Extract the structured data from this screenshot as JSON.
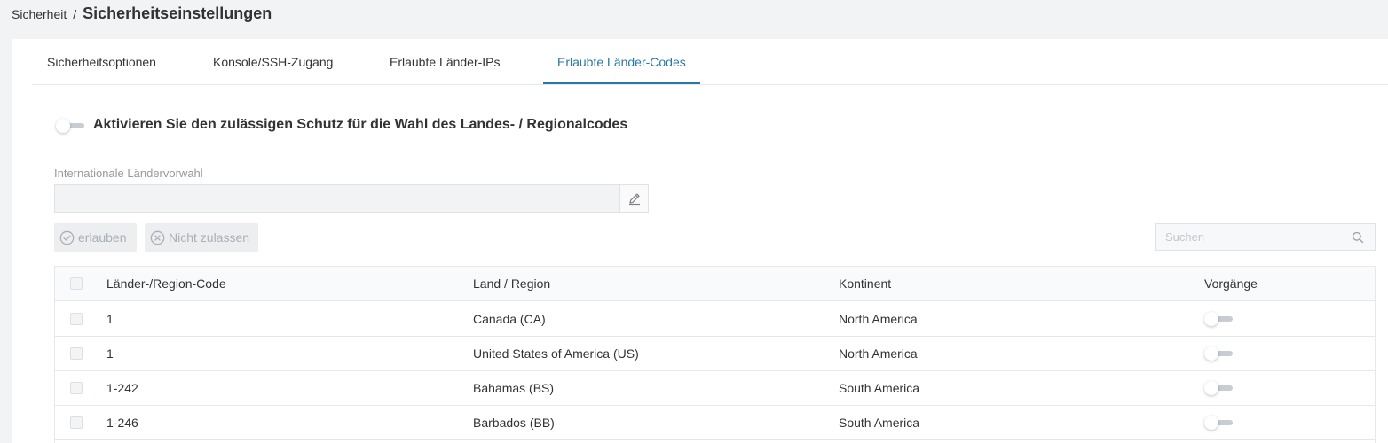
{
  "breadcrumb": {
    "parent": "Sicherheit",
    "separator": "/",
    "current": "Sicherheitseinstellungen"
  },
  "tabs": [
    {
      "label": "Sicherheitsoptionen",
      "active": false
    },
    {
      "label": "Konsole/SSH-Zugang",
      "active": false
    },
    {
      "label": "Erlaubte Länder-IPs",
      "active": false
    },
    {
      "label": "Erlaubte Länder-Codes",
      "active": true
    }
  ],
  "protection": {
    "label": "Aktivieren Sie den zulässigen Schutz für die Wahl des Landes- / Regionalcodes",
    "enabled": false
  },
  "country_code_field": {
    "label": "Internationale Ländervorwahl",
    "value": "",
    "edit_icon": "pencil-icon"
  },
  "actions": {
    "allow_label": "erlauben",
    "deny_label": "Nicht zulassen"
  },
  "search": {
    "placeholder": "Suchen"
  },
  "table": {
    "columns": [
      "Länder-/Region-Code",
      "Land / Region",
      "Kontinent",
      "Vorgänge"
    ],
    "rows": [
      {
        "code": "1",
        "country": "Canada (CA)",
        "continent": "North America",
        "enabled": false
      },
      {
        "code": "1",
        "country": "United States of America (US)",
        "continent": "North America",
        "enabled": false
      },
      {
        "code": "1-242",
        "country": "Bahamas (BS)",
        "continent": "South America",
        "enabled": false
      },
      {
        "code": "1-246",
        "country": "Barbados (BB)",
        "continent": "South America",
        "enabled": false
      }
    ]
  },
  "colors": {
    "accent": "#2a76a6",
    "page_background": "#f2f3f5",
    "disabled_text": "#aab0b6"
  }
}
